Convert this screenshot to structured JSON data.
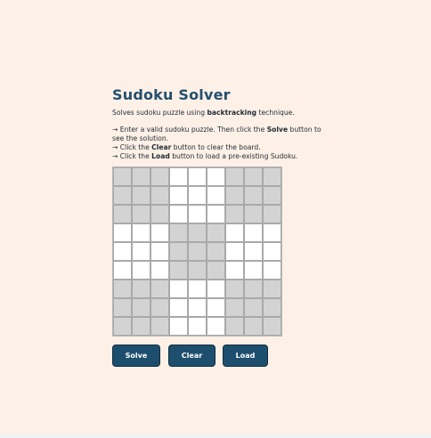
{
  "header": {
    "title": "Sudoku Solver",
    "subtitle_pre": "Solves sudoku puzzle using ",
    "subtitle_bold": "backtracking",
    "subtitle_post": " technique."
  },
  "instructions": {
    "line1_pre": "→ Enter a valid sudoku puzzle. Then click the ",
    "line1_bold": "Solve",
    "line1_post": " button to",
    "line2": "see the solution.",
    "line3_pre": "→ Click the ",
    "line3_bold": "Clear",
    "line3_post": " button to clear the board.",
    "line4_pre": "→ Click the ",
    "line4_bold": "Load",
    "line4_post": " button to load a pre-existing Sudoku."
  },
  "board": {
    "cells": [
      [
        "",
        "",
        "",
        "",
        "",
        "",
        "",
        "",
        ""
      ],
      [
        "",
        "",
        "",
        "",
        "",
        "",
        "",
        "",
        ""
      ],
      [
        "",
        "",
        "",
        "",
        "",
        "",
        "",
        "",
        ""
      ],
      [
        "",
        "",
        "",
        "",
        "",
        "",
        "",
        "",
        ""
      ],
      [
        "",
        "",
        "",
        "",
        "",
        "",
        "",
        "",
        ""
      ],
      [
        "",
        "",
        "",
        "",
        "",
        "",
        "",
        "",
        ""
      ],
      [
        "",
        "",
        "",
        "",
        "",
        "",
        "",
        "",
        ""
      ],
      [
        "",
        "",
        "",
        "",
        "",
        "",
        "",
        "",
        ""
      ],
      [
        "",
        "",
        "",
        "",
        "",
        "",
        "",
        "",
        ""
      ]
    ],
    "shaded_color": "#d3d3d3",
    "light_color": "#ffffff"
  },
  "buttons": {
    "solve": "Solve",
    "clear": "Clear",
    "load": "Load",
    "color": "#1e4e6e"
  }
}
